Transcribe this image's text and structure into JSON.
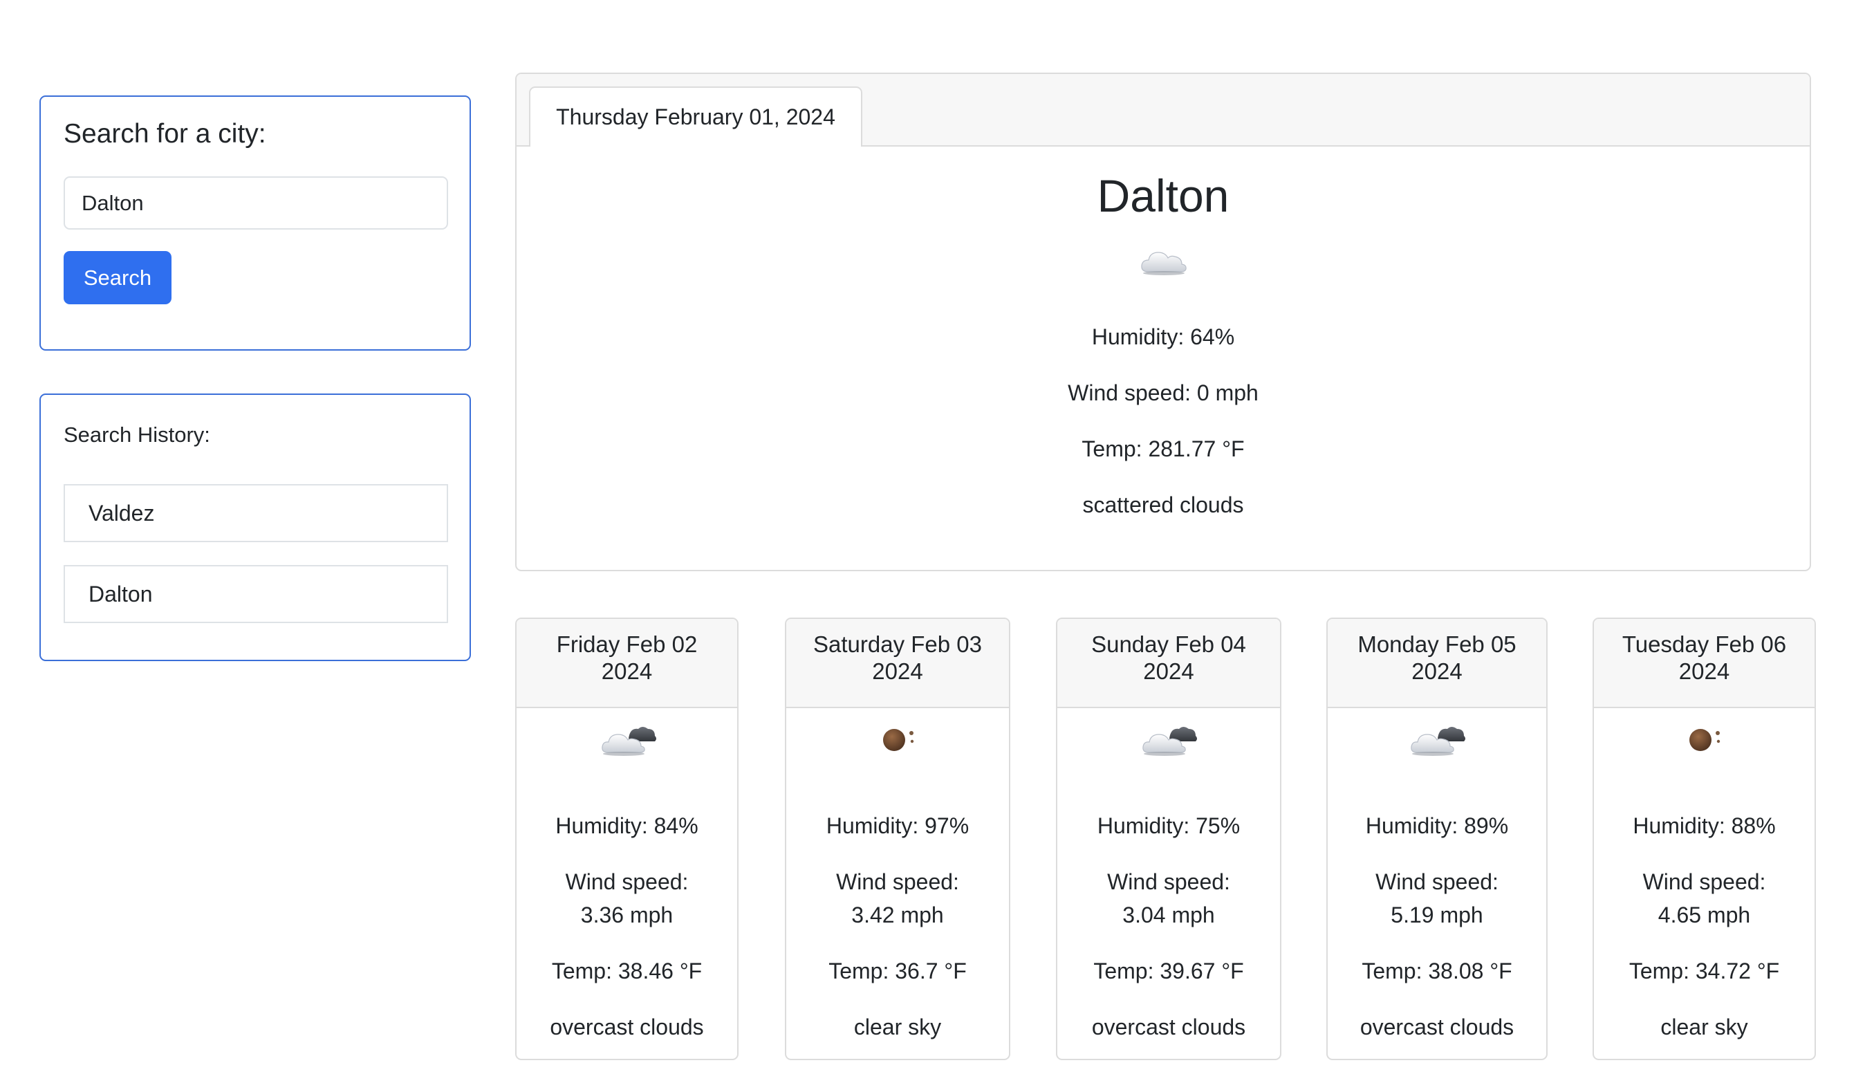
{
  "search": {
    "title": "Search for a city:",
    "input_value": "Dalton",
    "button_label": "Search"
  },
  "history": {
    "title": "Search History:",
    "items": [
      {
        "label": "Valdez"
      },
      {
        "label": "Dalton"
      }
    ]
  },
  "current": {
    "date": "Thursday February 01, 2024",
    "city": "Dalton",
    "icon": "cloud-icon",
    "humidity": "Humidity: 64%",
    "wind": "Wind speed: 0 mph",
    "temp": "Temp: 281.77 °F",
    "description": "scattered clouds"
  },
  "forecast": [
    {
      "date_line1": "Friday Feb 02",
      "date_line2": "2024",
      "icon": "overcast-clouds-icon",
      "humidity": "Humidity: 84%",
      "wind_label": "Wind speed:",
      "wind_value": "3.36 mph",
      "temp": "Temp: 38.46 °F",
      "description": "overcast clouds"
    },
    {
      "date_line1": "Saturday Feb 03",
      "date_line2": "2024",
      "icon": "clear-sky-icon",
      "humidity": "Humidity: 97%",
      "wind_label": "Wind speed:",
      "wind_value": "3.42 mph",
      "temp": "Temp: 36.7 °F",
      "description": "clear sky"
    },
    {
      "date_line1": "Sunday Feb 04",
      "date_line2": "2024",
      "icon": "overcast-clouds-icon",
      "humidity": "Humidity: 75%",
      "wind_label": "Wind speed:",
      "wind_value": "3.04 mph",
      "temp": "Temp: 39.67 °F",
      "description": "overcast clouds"
    },
    {
      "date_line1": "Monday Feb 05",
      "date_line2": "2024",
      "icon": "overcast-clouds-icon",
      "humidity": "Humidity: 89%",
      "wind_label": "Wind speed:",
      "wind_value": "5.19 mph",
      "temp": "Temp: 38.08 °F",
      "description": "overcast clouds"
    },
    {
      "date_line1": "Tuesday Feb 06",
      "date_line2": "2024",
      "icon": "clear-sky-icon",
      "humidity": "Humidity: 88%",
      "wind_label": "Wind speed:",
      "wind_value": "4.65 mph",
      "temp": "Temp: 34.72 °F",
      "description": "clear sky"
    }
  ],
  "colors": {
    "accent": "#2f6fef",
    "panel_border": "#3b6fd8",
    "card_border": "#dcdcdc",
    "header_bg": "#f7f7f7"
  }
}
